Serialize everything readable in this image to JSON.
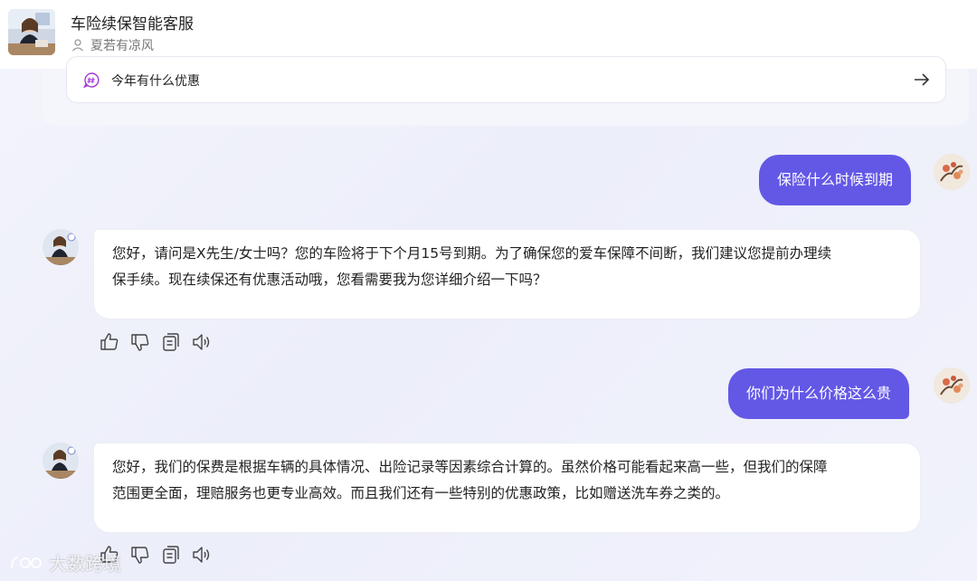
{
  "header": {
    "title": "车险续保智能客服",
    "username": "夏若有凉风"
  },
  "suggestion": {
    "question": "今年有什么优惠"
  },
  "messages": [
    {
      "role": "user",
      "text": "保险什么时候到期"
    },
    {
      "role": "bot",
      "line1": "您好，请问是X先生/女士吗？您的车险将于下个月15号到期。为了确保您的爱车保障不间断，我们建议您提前办理续",
      "line2": "保手续。现在续保还有优惠活动哦，您看需要我为您详细介绍一下吗？"
    },
    {
      "role": "user",
      "text": "你们为什么价格这么贵"
    },
    {
      "role": "bot",
      "line1": "您好，我们的保费是根据车辆的具体情况、出险记录等因素综合计算的。虽然价格可能看起来高一些，但我们的保障",
      "line2": "范围更全面，理赔服务也更专业高效。而且我们还有一些特别的优惠政策，比如赠送洗车券之类的。"
    }
  ],
  "watermark": "大数跨境",
  "colors": {
    "accent": "#6358e6",
    "background": "#eef0fa"
  },
  "icons": [
    "user-icon",
    "hash-chat-icon",
    "arrow-right-icon",
    "thumbs-up-icon",
    "thumbs-down-icon",
    "copy-icon",
    "speaker-icon"
  ]
}
